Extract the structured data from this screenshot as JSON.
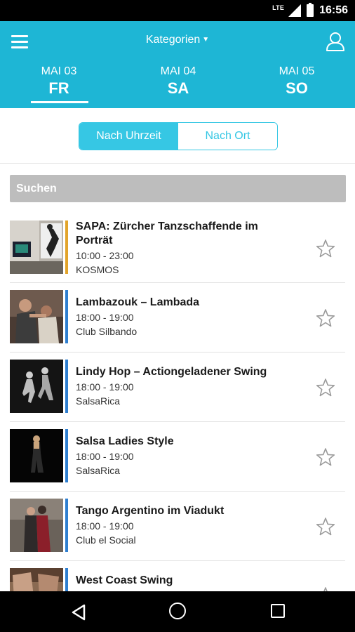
{
  "status_bar": {
    "network": "LTE",
    "time": "16:56"
  },
  "header": {
    "category_title": "Kategorien",
    "days": [
      {
        "month_day": "MAI 03",
        "weekday": "FR",
        "selected": true
      },
      {
        "month_day": "MAI 04",
        "weekday": "SA",
        "selected": false
      },
      {
        "month_day": "MAI 05",
        "weekday": "SO",
        "selected": false
      }
    ]
  },
  "sort_toggle": {
    "by_time": "Nach Uhrzeit",
    "by_place": "Nach Ort",
    "selected": "by_time"
  },
  "search": {
    "label": "Suchen"
  },
  "colors": {
    "header": "#1eb6d5",
    "accent": "#36c7e4",
    "orange_bar": "#e2a42b",
    "blue_bar": "#2f7fd0"
  },
  "events": [
    {
      "title_line1": "SAPA: Zürcher Tanzschaffende im",
      "title_line2": "Porträt",
      "time": "10:00 - 23:00",
      "venue": "KOSMOS",
      "bar_color": "#e2a42b",
      "icon": "star-outline-icon"
    },
    {
      "title_line1": "Lambazouk – Lambada",
      "title_line2": "",
      "time": "18:00 - 19:00",
      "venue": "Club Silbando",
      "bar_color": "#2f7fd0",
      "icon": "star-outline-icon"
    },
    {
      "title_line1": "Lindy Hop – Actiongeladener Swing",
      "title_line2": "",
      "time": "18:00 - 19:00",
      "venue": "SalsaRica",
      "bar_color": "#2f7fd0",
      "icon": "star-outline-icon"
    },
    {
      "title_line1": "Salsa Ladies Style",
      "title_line2": "",
      "time": "18:00 - 19:00",
      "venue": "SalsaRica",
      "bar_color": "#2f7fd0",
      "icon": "star-outline-icon"
    },
    {
      "title_line1": "Tango Argentino im Viadukt",
      "title_line2": "",
      "time": "18:00 - 19:00",
      "venue": "Club el Social",
      "bar_color": "#2f7fd0",
      "icon": "star-outline-icon"
    },
    {
      "title_line1": "West Coast Swing",
      "title_line2": "",
      "time": "",
      "venue": "",
      "bar_color": "#2f7fd0",
      "icon": "star-outline-icon"
    }
  ]
}
